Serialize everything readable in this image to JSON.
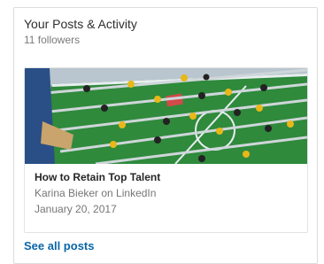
{
  "activity": {
    "title": "Your Posts & Activity",
    "followers": "11 followers"
  },
  "post": {
    "image": "foosball-table-photo",
    "title": "How to Retain Top Talent",
    "author": "Karina Bieker on LinkedIn",
    "date": "January 20, 2017"
  },
  "footer": {
    "see_all_label": "See all posts"
  },
  "colors": {
    "link": "#0a66a8",
    "field_green": "#2f8a3c",
    "player_yellow": "#e8b818"
  }
}
